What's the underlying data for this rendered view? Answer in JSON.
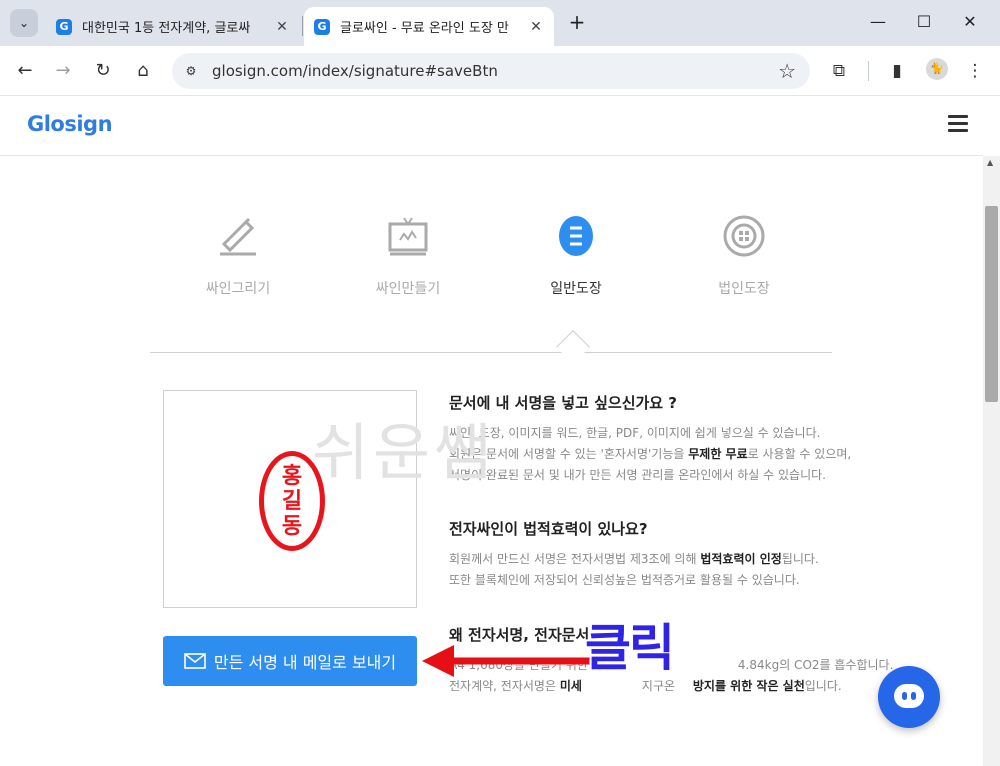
{
  "browser": {
    "tabs": [
      {
        "title": "대한민국 1등 전자계약, 글로싸",
        "active": false
      },
      {
        "title": "글로싸인 - 무료 온라인 도장 만",
        "active": true
      }
    ],
    "url": "glosign.com/index/signature#saveBtn",
    "window_controls": {
      "minimize": "—",
      "maximize": "☐",
      "close": "✕"
    }
  },
  "site": {
    "logo": "Glosign"
  },
  "signature_tabs": [
    {
      "label": "싸인그리기",
      "icon": "pen-draw-icon",
      "active": false
    },
    {
      "label": "싸인만들기",
      "icon": "monitor-signature-icon",
      "active": false
    },
    {
      "label": "일반도장",
      "icon": "stamp-icon",
      "active": true
    },
    {
      "label": "법인도장",
      "icon": "corporate-seal-icon",
      "active": false
    }
  ],
  "stamp": {
    "chars": [
      "홍",
      "길",
      "동"
    ],
    "color": "#e8161c"
  },
  "watermark": "쉬운쌤",
  "send_button": {
    "label": "만든 서명 내 메일로 보내기"
  },
  "info": {
    "q1": {
      "title": "문서에 내 서명을 넣고 싶으신가요 ?",
      "line1": "싸인, 도장, 이미지를 워드, 한글, PDF, 이미지에 쉽게 넣으실 수 있습니다.",
      "line2_pre": "회원은 문서에 서명할 수 있는 '혼자서명'기능을 ",
      "line2_bold": "무제한 무료",
      "line2_post": "로 사용할 수 있으며,",
      "line3": "서명이 완료된 문서 및 내가 만든 서명 관리를 온라인에서 하실 수 있습니다."
    },
    "q2": {
      "title": "전자싸인이 법적효력이 있나요?",
      "line1_pre": "회원께서 만드신 서명은 전자서명법 제3조에 의해 ",
      "line1_bold": "법적효력이 인정",
      "line1_post": "됩니다.",
      "line2": "또한 블록체인에 저장되어 신뢰성높은 법적증거로 활용될 수 있습니다."
    },
    "q3": {
      "title": "왜 전자서명, 전자문서",
      "line1": "A4 1,680장을 만들기 위한",
      "line1_end": "4.84kg의 CO2를 흡수합니다.",
      "line2_pre": "전자계약, 전자서명은 ",
      "line2_b1": "미세",
      "line2_mid": "지구온",
      "line2_b2": "방지를 위한 작은 실천",
      "line2_post": "입니다."
    }
  },
  "annotation": {
    "click_label": "클릭",
    "arrow_color": "#e60f14",
    "text_color": "#2f24e6"
  },
  "colors": {
    "brand": "#2f7de1",
    "button": "#2e8ef0",
    "chat": "#2567e8"
  }
}
